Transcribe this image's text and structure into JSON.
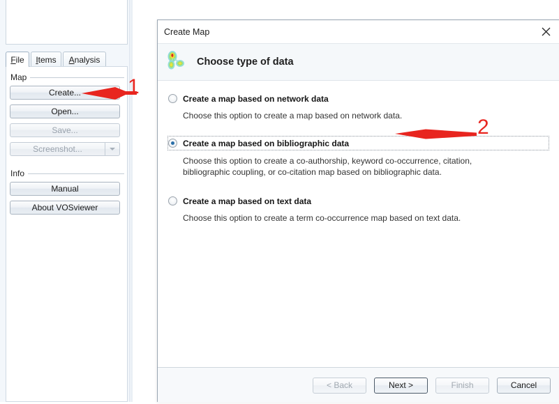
{
  "app": {
    "left_panel": {
      "tabs": [
        {
          "id": "file",
          "label": "File",
          "mnemonic": "F",
          "rest": "ile",
          "selected": true
        },
        {
          "id": "items",
          "label": "Items",
          "mnemonic": "I",
          "rest": "tems",
          "selected": false
        },
        {
          "id": "analysis",
          "label": "Analysis",
          "mnemonic": "A",
          "rest": "nalysis",
          "selected": false
        }
      ],
      "groups": [
        {
          "title": "Map",
          "buttons": [
            {
              "label": "Create...",
              "enabled": true
            },
            {
              "label": "Open...",
              "enabled": true
            },
            {
              "label": "Save...",
              "enabled": false
            },
            {
              "label": "Screenshot...",
              "enabled": false,
              "split": true,
              "dropdown_icon": "chevron-down-icon"
            }
          ]
        },
        {
          "title": "Info",
          "buttons": [
            {
              "label": "Manual",
              "enabled": true
            },
            {
              "label": "About VOSviewer",
              "enabled": true
            }
          ]
        }
      ]
    }
  },
  "dialog": {
    "title": "Create Map",
    "close_icon": "close-icon",
    "logo_icon": "vosviewer-density-logo-icon",
    "heading": "Choose type of data",
    "options": [
      {
        "id": "network",
        "label": "Create a map based on network data",
        "description": "Choose this option to create a map based on network data.",
        "selected": false,
        "focused": false
      },
      {
        "id": "bibliographic",
        "label": "Create a map based on bibliographic data",
        "description": "Choose this option to create a co-authorship, keyword co-occurrence, citation, bibliographic coupling, or co-citation map based on bibliographic data.",
        "selected": true,
        "focused": true
      },
      {
        "id": "text",
        "label": "Create a map based on text data",
        "description": "Choose this option to create a term co-occurrence map based on text data.",
        "selected": false,
        "focused": false
      }
    ],
    "footer_buttons": [
      {
        "id": "back",
        "label": "< Back",
        "enabled": false,
        "default": false
      },
      {
        "id": "next",
        "label": "Next >",
        "enabled": true,
        "default": true
      },
      {
        "id": "finish",
        "label": "Finish",
        "enabled": false,
        "default": false
      },
      {
        "id": "cancel",
        "label": "Cancel",
        "enabled": true,
        "default": false
      }
    ]
  },
  "annotations": {
    "color": "#e8251f",
    "callouts": [
      {
        "number": "1",
        "points_to": "Create... button"
      },
      {
        "number": "2",
        "points_to": "Create a map based on bibliographic data option"
      }
    ]
  }
}
